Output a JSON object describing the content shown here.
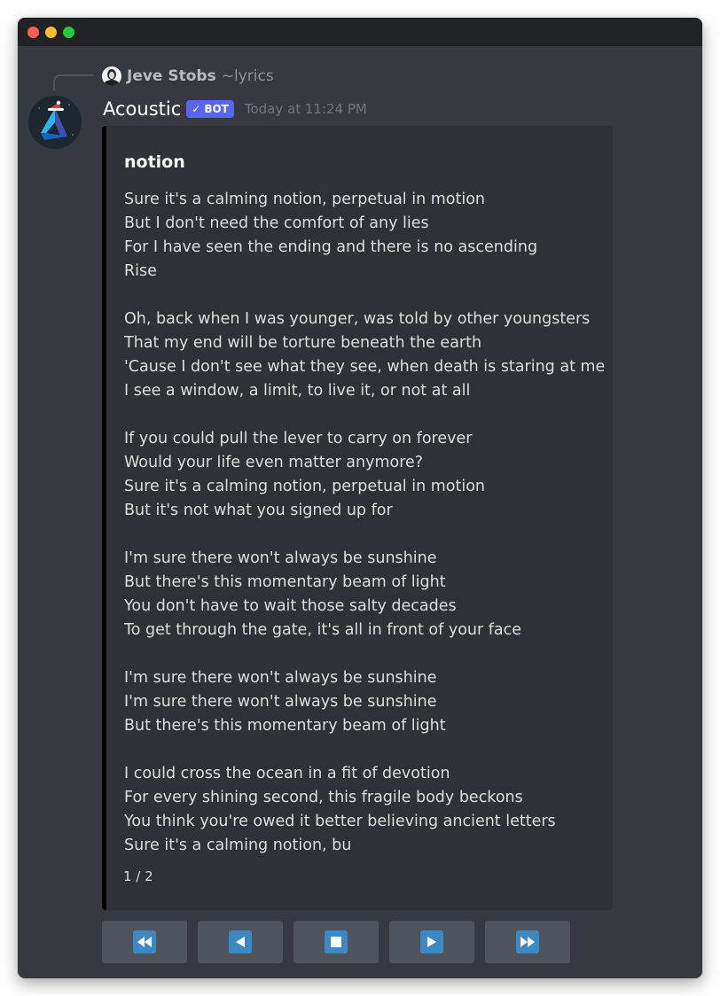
{
  "window": {
    "controls": [
      "close",
      "minimize",
      "maximize"
    ]
  },
  "reply": {
    "avatar_icon": "user-avatar-icon",
    "username": "Jeve Stobs",
    "command": "~lyrics"
  },
  "message": {
    "avatar_icon": "acoustic-bot-avatar-icon",
    "username": "Acoustic",
    "bot_tag": "BOT",
    "bot_tag_check": "✓",
    "timestamp": "Today at 11:24 PM"
  },
  "embed": {
    "accent_color": "#000000",
    "title": "notion",
    "lyrics": "Sure it's a calming notion, perpetual in motion\nBut I don't need the comfort of any lies\nFor I have seen the ending and there is no ascending\nRise\n\nOh, back when I was younger, was told by other youngsters\nThat my end will be torture beneath the earth\n'Cause I don't see what they see, when death is staring at me\nI see a window, a limit, to live it, or not at all\n\nIf you could pull the lever to carry on forever\nWould your life even matter anymore?\nSure it's a calming notion, perpetual in motion\nBut it's not what you signed up for\n\nI'm sure there won't always be sunshine\nBut there's this momentary beam of light\nYou don't have to wait those salty decades\nTo get through the gate, it's all in front of your face\n\nI'm sure there won't always be sunshine\nI'm sure there won't always be sunshine\nBut there's this momentary beam of light\n\nI could cross the ocean in a fit of devotion\nFor every shining second, this fragile body beckons\nYou think you're owed it better believing ancient letters\nSure it's a calming notion, bu",
    "footer": "1 / 2"
  },
  "buttons": [
    {
      "name": "first-page-button",
      "icon": "fast-reverse-icon"
    },
    {
      "name": "previous-page-button",
      "icon": "reverse-icon"
    },
    {
      "name": "stop-button",
      "icon": "stop-icon"
    },
    {
      "name": "next-page-button",
      "icon": "play-icon"
    },
    {
      "name": "last-page-button",
      "icon": "fast-forward-icon"
    }
  ],
  "colors": {
    "background": "#36393f",
    "titlebar": "#202225",
    "embed_background": "#2f3136",
    "bot_tag": "#5865f2",
    "button": "#4f545c",
    "button_icon": "#3b88c3"
  }
}
